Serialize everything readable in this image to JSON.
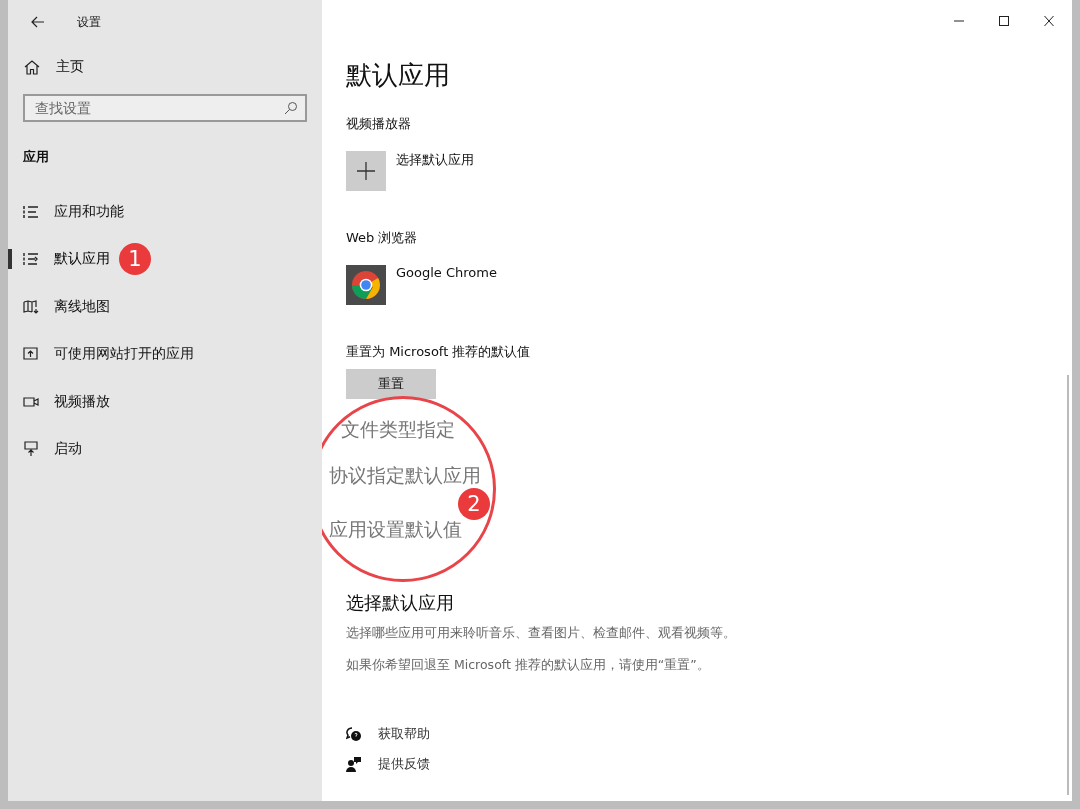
{
  "window": {
    "title": "设置"
  },
  "sidebar": {
    "home": "主页",
    "search": {
      "placeholder": "查找设置"
    },
    "section": "应用",
    "items": [
      {
        "label": "应用和功能",
        "selected": false
      },
      {
        "label": "默认应用",
        "selected": true,
        "badge": "1"
      },
      {
        "label": "离线地图",
        "selected": false
      },
      {
        "label": "可使用网站打开的应用",
        "selected": false
      },
      {
        "label": "视频播放",
        "selected": false
      },
      {
        "label": "启动",
        "selected": false
      }
    ]
  },
  "main": {
    "title": "默认应用",
    "groups": [
      {
        "heading": "视频播放器",
        "app": {
          "kind": "add",
          "name": "选择默认应用"
        }
      },
      {
        "heading": "Web 浏览器",
        "app": {
          "kind": "chrome",
          "name": "Google Chrome"
        }
      }
    ],
    "reset": {
      "label": "重置为 Microsoft 推荐的默认值",
      "button": "重置"
    },
    "magnifier": {
      "lines": [
        "文件类型指定",
        "协议指定默认应用",
        "应用设置默认值"
      ],
      "badge": "2"
    },
    "info": {
      "title": "选择默认应用",
      "lines": [
        "选择哪些应用可用来聆听音乐、查看图片、检查邮件、观看视频等。",
        "如果你希望回退至 Microsoft 推荐的默认应用，请使用“重置”。"
      ]
    },
    "links": [
      {
        "label": "获取帮助"
      },
      {
        "label": "提供反馈"
      }
    ]
  }
}
